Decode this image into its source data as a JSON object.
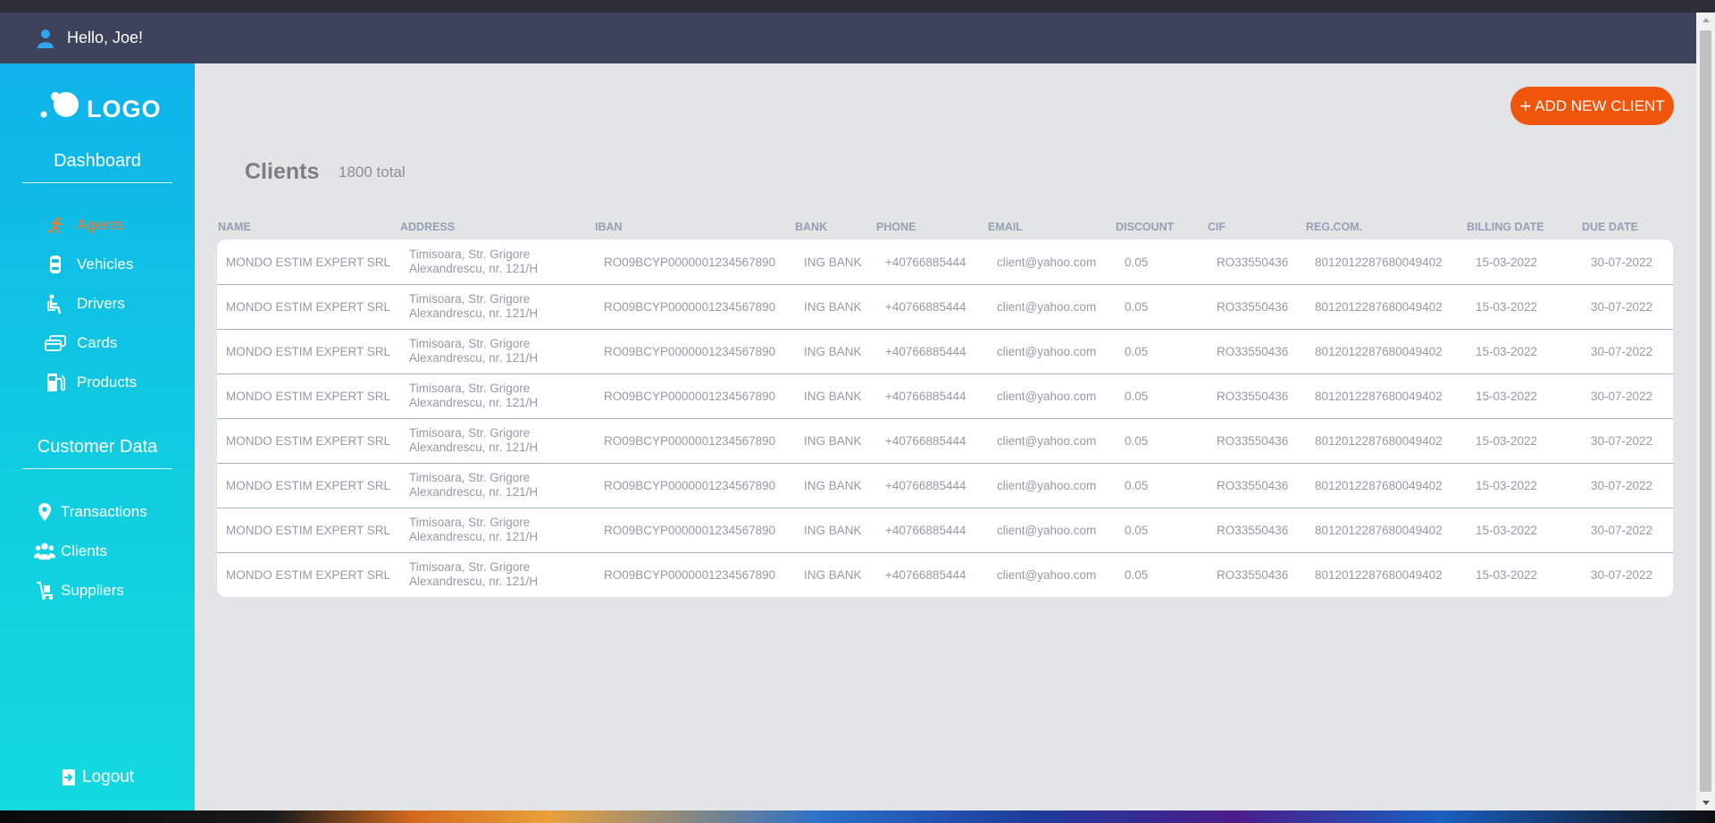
{
  "header": {
    "greeting": "Hello, Joe!"
  },
  "sidebar": {
    "logo_text": "LOGO",
    "dashboard_title": "Dashboard",
    "dashboard_items": [
      {
        "label": "Agents",
        "icon": "running-person-icon",
        "active": true
      },
      {
        "label": "Vehicles",
        "icon": "car-icon",
        "active": false
      },
      {
        "label": "Drivers",
        "icon": "driver-seat-icon",
        "active": false
      },
      {
        "label": "Cards",
        "icon": "card-icon",
        "active": false
      },
      {
        "label": "Products",
        "icon": "fuel-pump-icon",
        "active": false
      }
    ],
    "customer_title": "Customer Data",
    "customer_items": [
      {
        "label": "Transactions",
        "icon": "location-pin-icon"
      },
      {
        "label": "Clients",
        "icon": "users-icon"
      },
      {
        "label": "Suppliers",
        "icon": "hand-truck-icon"
      }
    ],
    "logout_label": "Logout"
  },
  "main": {
    "add_button_label": "ADD NEW CLIENT",
    "title": "Clients",
    "total": "1800 total",
    "columns": [
      "NAME",
      "ADDRESS",
      "IBAN",
      "BANK",
      "PHONE",
      "EMAIL",
      "DISCOUNT",
      "CIF",
      "REG.COM.",
      "BILLING DATE",
      "DUE DATE"
    ],
    "rows": [
      {
        "name": "MONDO ESTIM EXPERT SRL",
        "address": "Timisoara, Str. Grigore Alexandrescu, nr. 121/H",
        "iban": "RO09BCYP0000001234567890",
        "bank": "ING BANK",
        "phone": "+40766885444",
        "email": "client@yahoo.com",
        "discount": "0.05",
        "cif": "RO33550436",
        "regcom": "8012012287680049402",
        "billing": "15-03-2022",
        "due": "30-07-2022"
      },
      {
        "name": "MONDO ESTIM EXPERT SRL",
        "address": "Timisoara, Str. Grigore Alexandrescu, nr. 121/H",
        "iban": "RO09BCYP0000001234567890",
        "bank": "ING BANK",
        "phone": "+40766885444",
        "email": "client@yahoo.com",
        "discount": "0.05",
        "cif": "RO33550436",
        "regcom": "8012012287680049402",
        "billing": "15-03-2022",
        "due": "30-07-2022"
      },
      {
        "name": "MONDO ESTIM EXPERT SRL",
        "address": "Timisoara, Str. Grigore Alexandrescu, nr. 121/H",
        "iban": "RO09BCYP0000001234567890",
        "bank": "ING BANK",
        "phone": "+40766885444",
        "email": "client@yahoo.com",
        "discount": "0.05",
        "cif": "RO33550436",
        "regcom": "8012012287680049402",
        "billing": "15-03-2022",
        "due": "30-07-2022"
      },
      {
        "name": "MONDO ESTIM EXPERT SRL",
        "address": "Timisoara, Str. Grigore Alexandrescu, nr. 121/H",
        "iban": "RO09BCYP0000001234567890",
        "bank": "ING BANK",
        "phone": "+40766885444",
        "email": "client@yahoo.com",
        "discount": "0.05",
        "cif": "RO33550436",
        "regcom": "8012012287680049402",
        "billing": "15-03-2022",
        "due": "30-07-2022"
      },
      {
        "name": "MONDO ESTIM EXPERT SRL",
        "address": "Timisoara, Str. Grigore Alexandrescu, nr. 121/H",
        "iban": "RO09BCYP0000001234567890",
        "bank": "ING BANK",
        "phone": "+40766885444",
        "email": "client@yahoo.com",
        "discount": "0.05",
        "cif": "RO33550436",
        "regcom": "8012012287680049402",
        "billing": "15-03-2022",
        "due": "30-07-2022"
      },
      {
        "name": "MONDO ESTIM EXPERT SRL",
        "address": "Timisoara, Str. Grigore Alexandrescu, nr. 121/H",
        "iban": "RO09BCYP0000001234567890",
        "bank": "ING BANK",
        "phone": "+40766885444",
        "email": "client@yahoo.com",
        "discount": "0.05",
        "cif": "RO33550436",
        "regcom": "8012012287680049402",
        "billing": "15-03-2022",
        "due": "30-07-2022"
      },
      {
        "name": "MONDO ESTIM EXPERT SRL",
        "address": "Timisoara, Str. Grigore Alexandrescu, nr. 121/H",
        "iban": "RO09BCYP0000001234567890",
        "bank": "ING BANK",
        "phone": "+40766885444",
        "email": "client@yahoo.com",
        "discount": "0.05",
        "cif": "RO33550436",
        "regcom": "8012012287680049402",
        "billing": "15-03-2022",
        "due": "30-07-2022"
      },
      {
        "name": "MONDO ESTIM EXPERT SRL",
        "address": "Timisoara, Str. Grigore Alexandrescu, nr. 121/H",
        "iban": "RO09BCYP0000001234567890",
        "bank": "ING BANK",
        "phone": "+40766885444",
        "email": "client@yahoo.com",
        "discount": "0.05",
        "cif": "RO33550436",
        "regcom": "8012012287680049402",
        "billing": "15-03-2022",
        "due": "30-07-2022"
      }
    ]
  },
  "colors": {
    "accent": "#f1540b",
    "header": "#3e435b",
    "sidebar_top": "#0fb2ea",
    "sidebar_bottom": "#14d9df",
    "active_nav": "#f07a2a"
  }
}
